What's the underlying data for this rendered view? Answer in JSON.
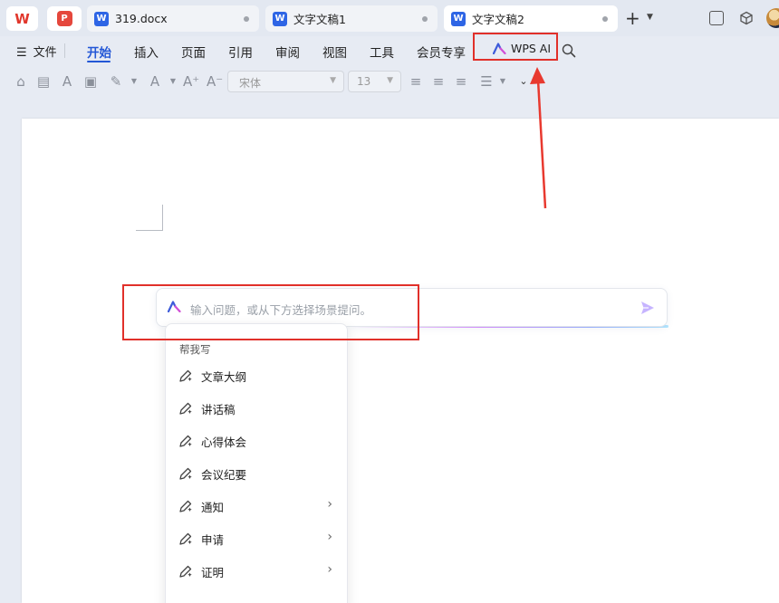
{
  "tabs": [
    {
      "title": "319.docx"
    },
    {
      "title": "文字文稿1"
    },
    {
      "title": "文字文稿2"
    }
  ],
  "menu": {
    "file": "文件",
    "items": [
      "开始",
      "插入",
      "页面",
      "引用",
      "审阅",
      "视图",
      "工具",
      "会员专享"
    ],
    "wps_ai": "WPS AI"
  },
  "toolbar": {
    "font": "宋体",
    "size": "13"
  },
  "ai_input": {
    "placeholder": "输入问题，或从下方选择场景提问。"
  },
  "dropdown": {
    "header": "帮我写",
    "items": [
      {
        "label": "文章大纲",
        "has_submenu": false
      },
      {
        "label": "讲话稿",
        "has_submenu": false
      },
      {
        "label": "心得体会",
        "has_submenu": false
      },
      {
        "label": "会议纪要",
        "has_submenu": false
      },
      {
        "label": "通知",
        "has_submenu": true
      },
      {
        "label": "申请",
        "has_submenu": true
      },
      {
        "label": "证明",
        "has_submenu": true
      }
    ]
  },
  "colors": {
    "accent": "#2357d6",
    "annotation": "#e1302a",
    "word_icon": "#2e65e5",
    "wps_logo": "#e1372c"
  }
}
